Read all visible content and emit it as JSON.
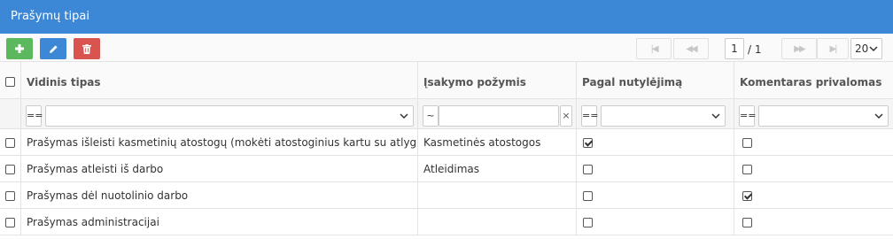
{
  "title": "Prašymų tipai",
  "toolbar": {
    "add_icon": "plus-icon",
    "edit_icon": "pencil-icon",
    "delete_icon": "trash-icon"
  },
  "pager": {
    "page": "1",
    "total": "/ 1",
    "page_size": "20"
  },
  "columns": [
    "Vidinis tipas",
    "Įsakymo požymis",
    "Pagal nutylėjimą",
    "Komentaras privalomas"
  ],
  "filters": {
    "col1_op": "==",
    "col2_op": "~",
    "col2_clear": "×",
    "col3_op": "==",
    "col4_op": "=="
  },
  "rows": [
    {
      "type": "Prašymas išleisti kasmetinių atostogų (mokėti atostoginius kartu su atlyginimu)",
      "flag": "Kasmetinės atostogos",
      "default": true,
      "comment_required": false
    },
    {
      "type": "Prašymas atleisti iš darbo",
      "flag": "Atleidimas",
      "default": false,
      "comment_required": false
    },
    {
      "type": "Prašymas dėl nuotolinio darbo",
      "flag": "",
      "default": false,
      "comment_required": true
    },
    {
      "type": "Prašymas administracijai",
      "flag": "",
      "default": false,
      "comment_required": false
    }
  ],
  "colors": {
    "header": "#3c87d6",
    "add": "#5cb85c",
    "edit": "#3c87d6",
    "delete": "#d9534f"
  }
}
